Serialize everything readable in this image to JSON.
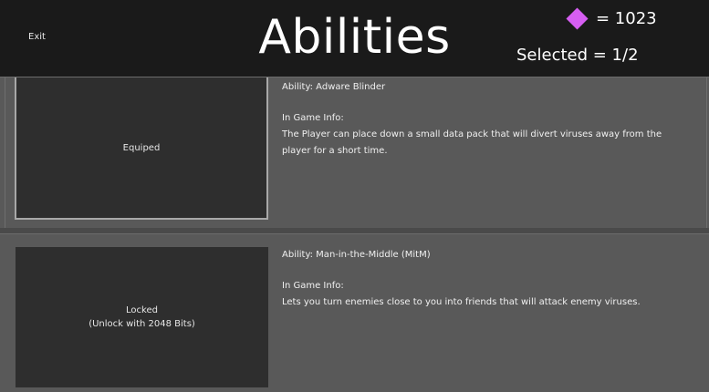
{
  "header": {
    "exit_label": "Exit",
    "title": "Abilities",
    "currency_text": "= 1023",
    "selected_text": "Selected = 1/2",
    "currency_icon": "diamond-icon",
    "currency_color": "#d65ef2"
  },
  "abilities": [
    {
      "status": "Equiped",
      "name_line": "Ability: Adware Blinder",
      "info_heading": "In Game Info:",
      "description": "The Player can place down a small data pack that will divert viruses away from the player for a short time."
    },
    {
      "status": "Locked\n(Unlock with 2048 Bits)",
      "name_line": "Ability: Man-in-the-Middle (MitM)",
      "info_heading": "In Game Info:",
      "description": "Lets you turn enemies close to you into friends that will attack enemy viruses."
    }
  ]
}
